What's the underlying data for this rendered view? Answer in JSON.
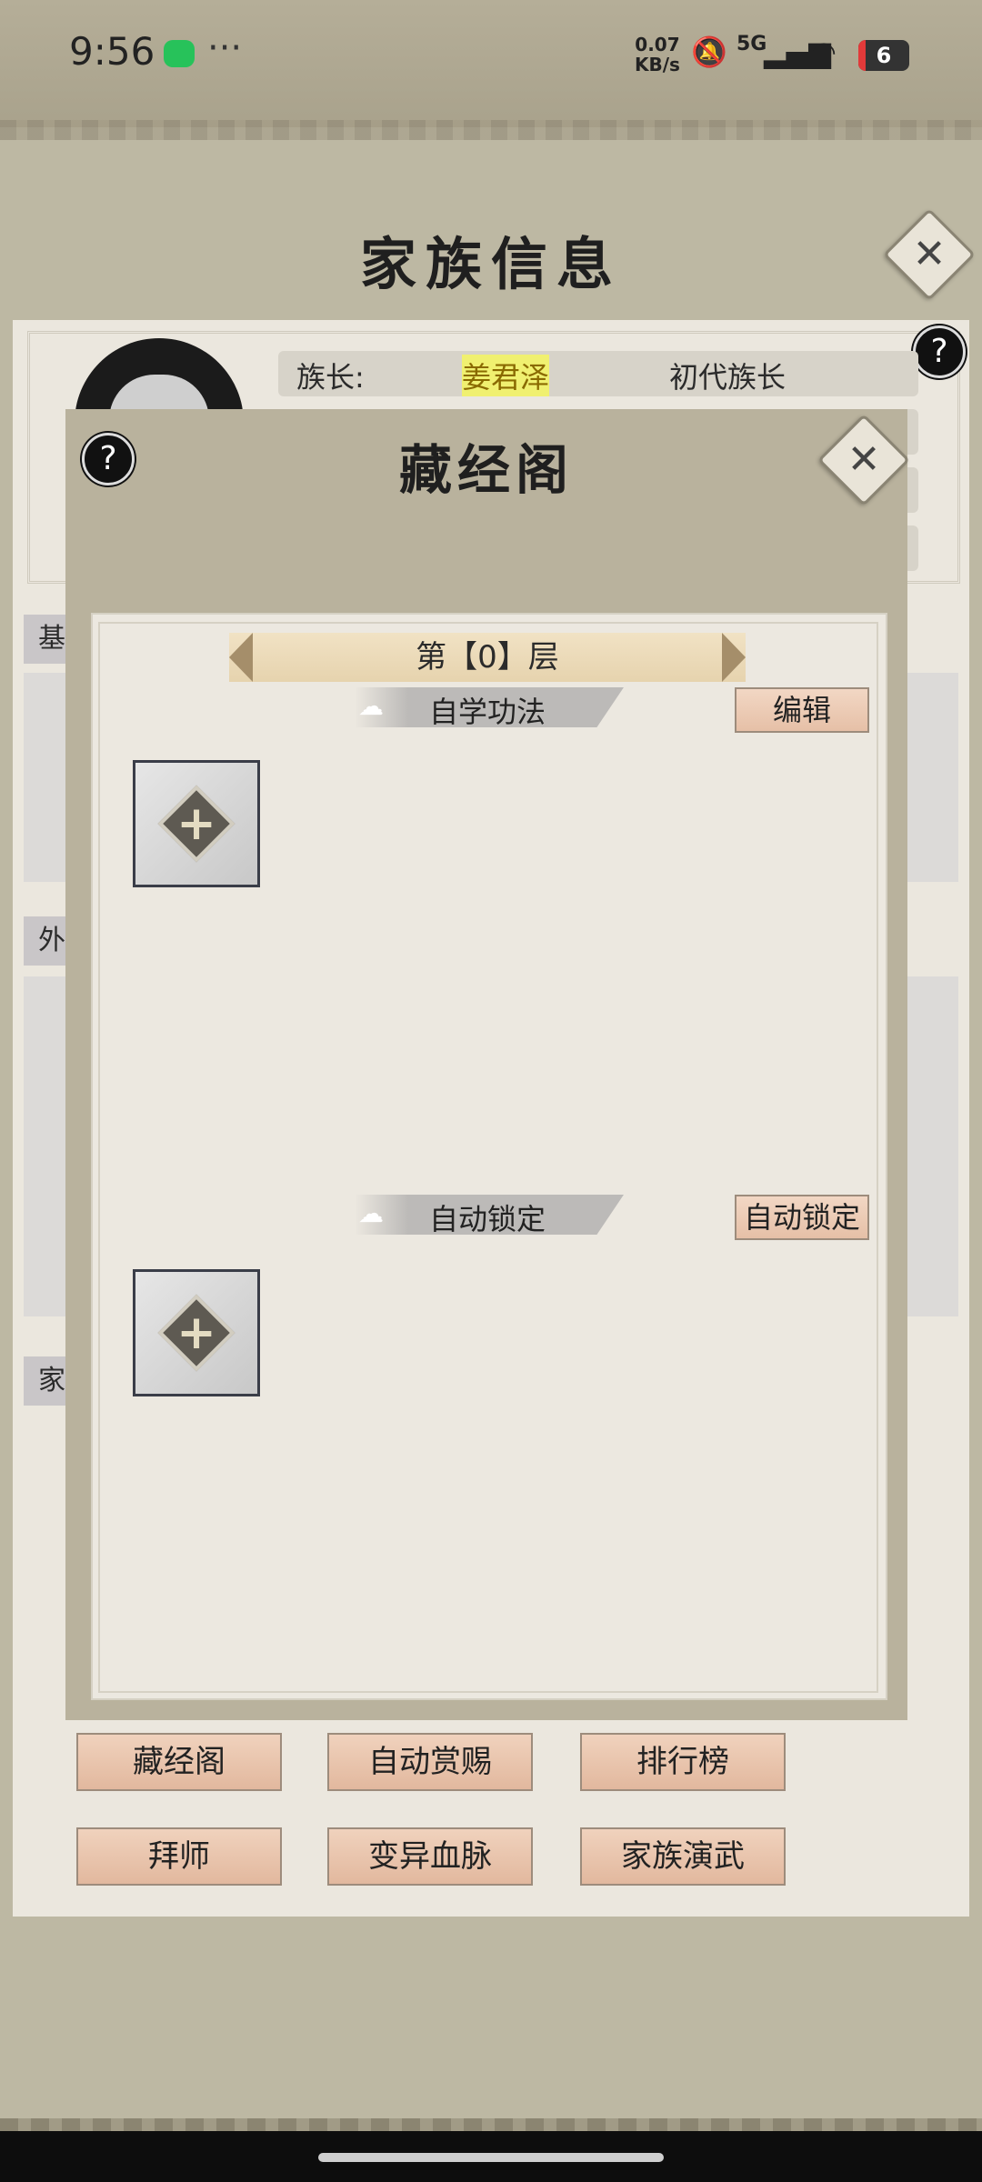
{
  "status_bar": {
    "time": "9:56",
    "more": "···",
    "net_speed_value": "0.07",
    "net_speed_unit": "KB/s",
    "network": "5G",
    "battery": "6"
  },
  "family_info": {
    "title": "家族信息",
    "leader_label": "族长:",
    "leader_name": "姜君泽",
    "leader_title": "初代族长",
    "side_tabs": [
      "基",
      "外",
      "家"
    ]
  },
  "bottom_buttons": {
    "row1": [
      "藏经阁",
      "自动赏赐",
      "排行榜"
    ],
    "row2": [
      "拜师",
      "变异血脉",
      "家族演武"
    ]
  },
  "modal": {
    "title": "藏经阁",
    "floor_label": "第【0】层",
    "section1_label": "自学功法",
    "edit_button": "编辑",
    "section2_label": "自动锁定",
    "auto_lock_button": "自动锁定"
  },
  "icons": {
    "close": "close-icon",
    "help": "help-icon",
    "add": "plus-icon"
  }
}
